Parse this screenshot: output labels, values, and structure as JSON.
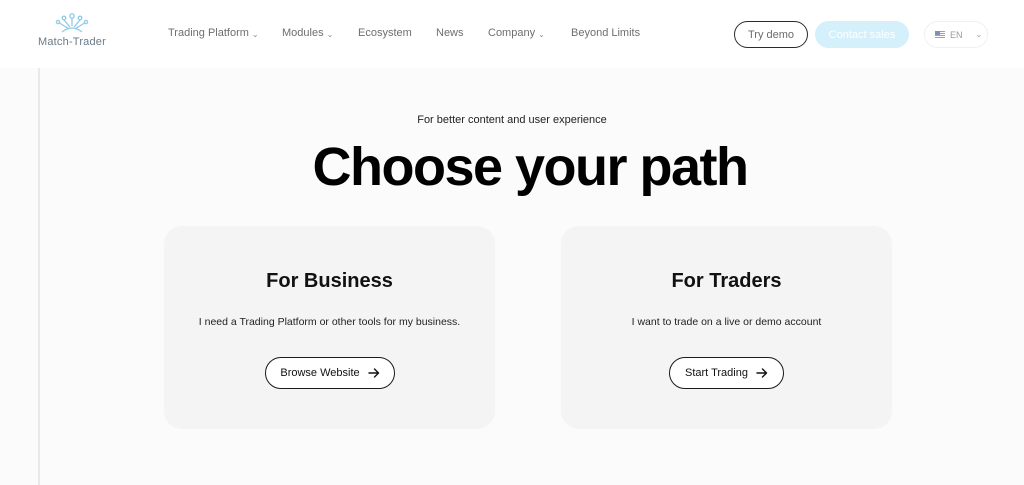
{
  "brand": {
    "name": "Match-Trader"
  },
  "nav": {
    "items": [
      {
        "label": "Trading Platform",
        "has_dropdown": true
      },
      {
        "label": "Modules",
        "has_dropdown": true
      },
      {
        "label": "Ecosystem",
        "has_dropdown": false
      },
      {
        "label": "News",
        "has_dropdown": false
      },
      {
        "label": "Company",
        "has_dropdown": true
      },
      {
        "label": "Beyond Limits",
        "has_dropdown": false
      }
    ],
    "chevron_glyph": "⌄"
  },
  "header_actions": {
    "try_demo": "Try demo",
    "contact_sales": "Contact sales",
    "language": "EN"
  },
  "hero": {
    "kicker": "For better content and user experience",
    "title": "Choose your path"
  },
  "cards": [
    {
      "title": "For Business",
      "description": "I need a Trading Platform or other tools for my business.",
      "button": "Browse Website"
    },
    {
      "title": "For Traders",
      "description": "I want to trade on a live or demo account",
      "button": "Start Trading"
    }
  ],
  "colors": {
    "accent": "#d3f0fb",
    "logo": "#8fcbe6",
    "background": "#fbfbfb",
    "card": "#f4f4f4"
  },
  "icons": [
    "logo-icon",
    "chevron-down-icon",
    "us-flag-icon",
    "arrow-right-icon"
  ]
}
